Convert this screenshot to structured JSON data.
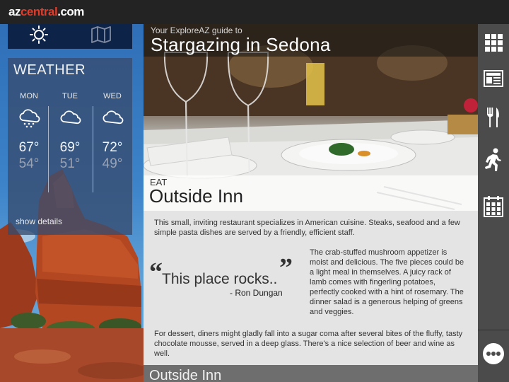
{
  "app": {
    "logo_prefix": "az",
    "logo_main": "central",
    "logo_suffix": ".com"
  },
  "weather_tabs": {
    "sun_icon": "sun-icon",
    "map_icon": "map-icon"
  },
  "weather": {
    "title": "WEATHER",
    "days": [
      {
        "name": "MON",
        "icon": "rain-cloud-icon",
        "high": "67°",
        "low": "54°"
      },
      {
        "name": "TUE",
        "icon": "cloud-icon",
        "high": "69°",
        "low": "51°"
      },
      {
        "name": "WED",
        "icon": "cloud-icon",
        "high": "72°",
        "low": "49°"
      }
    ],
    "show_details": "show details"
  },
  "guide": {
    "subtitle": "Your ExploreAZ guide to",
    "title": "Stargazing in Sedona"
  },
  "listing": {
    "category": "EAT",
    "name": "Outside Inn",
    "intro": "This small, inviting restaurant specializes in American cuisine. Steaks, seafood and a few simple pasta dishes are served by a friendly, efficient staff.",
    "quote": "This place rocks..",
    "quote_open": "“",
    "quote_close": "”",
    "quote_author": "- Ron Dungan",
    "review": "The crab-stuffed mushroom appetizer is moist and delicious. The five pieces could be a light meal in themselves. A juicy rack of lamb comes with fingerling potatoes, perfectly cooked with a hint of rosemary. The dinner salad is a generous helping of greens and veggies.",
    "dessert": "For dessert, diners might gladly fall into a sugar coma after several bites of the fluffy, tasty chocolate mousse, served in a deep glass. There's a nice selection of beer and wine as well."
  },
  "next": {
    "title": "Outside Inn"
  },
  "sidebar": {
    "items": [
      {
        "icon": "grid-icon"
      },
      {
        "icon": "newspaper-icon"
      },
      {
        "icon": "fork-knife-icon"
      },
      {
        "icon": "running-person-icon"
      },
      {
        "icon": "calendar-icon"
      },
      {
        "icon": "more-icon"
      }
    ]
  },
  "colors": {
    "logo_accent": "#e23b2a",
    "weather_tab_bg": "#0e2348",
    "sidebar_bg": "#4b4b4b"
  }
}
